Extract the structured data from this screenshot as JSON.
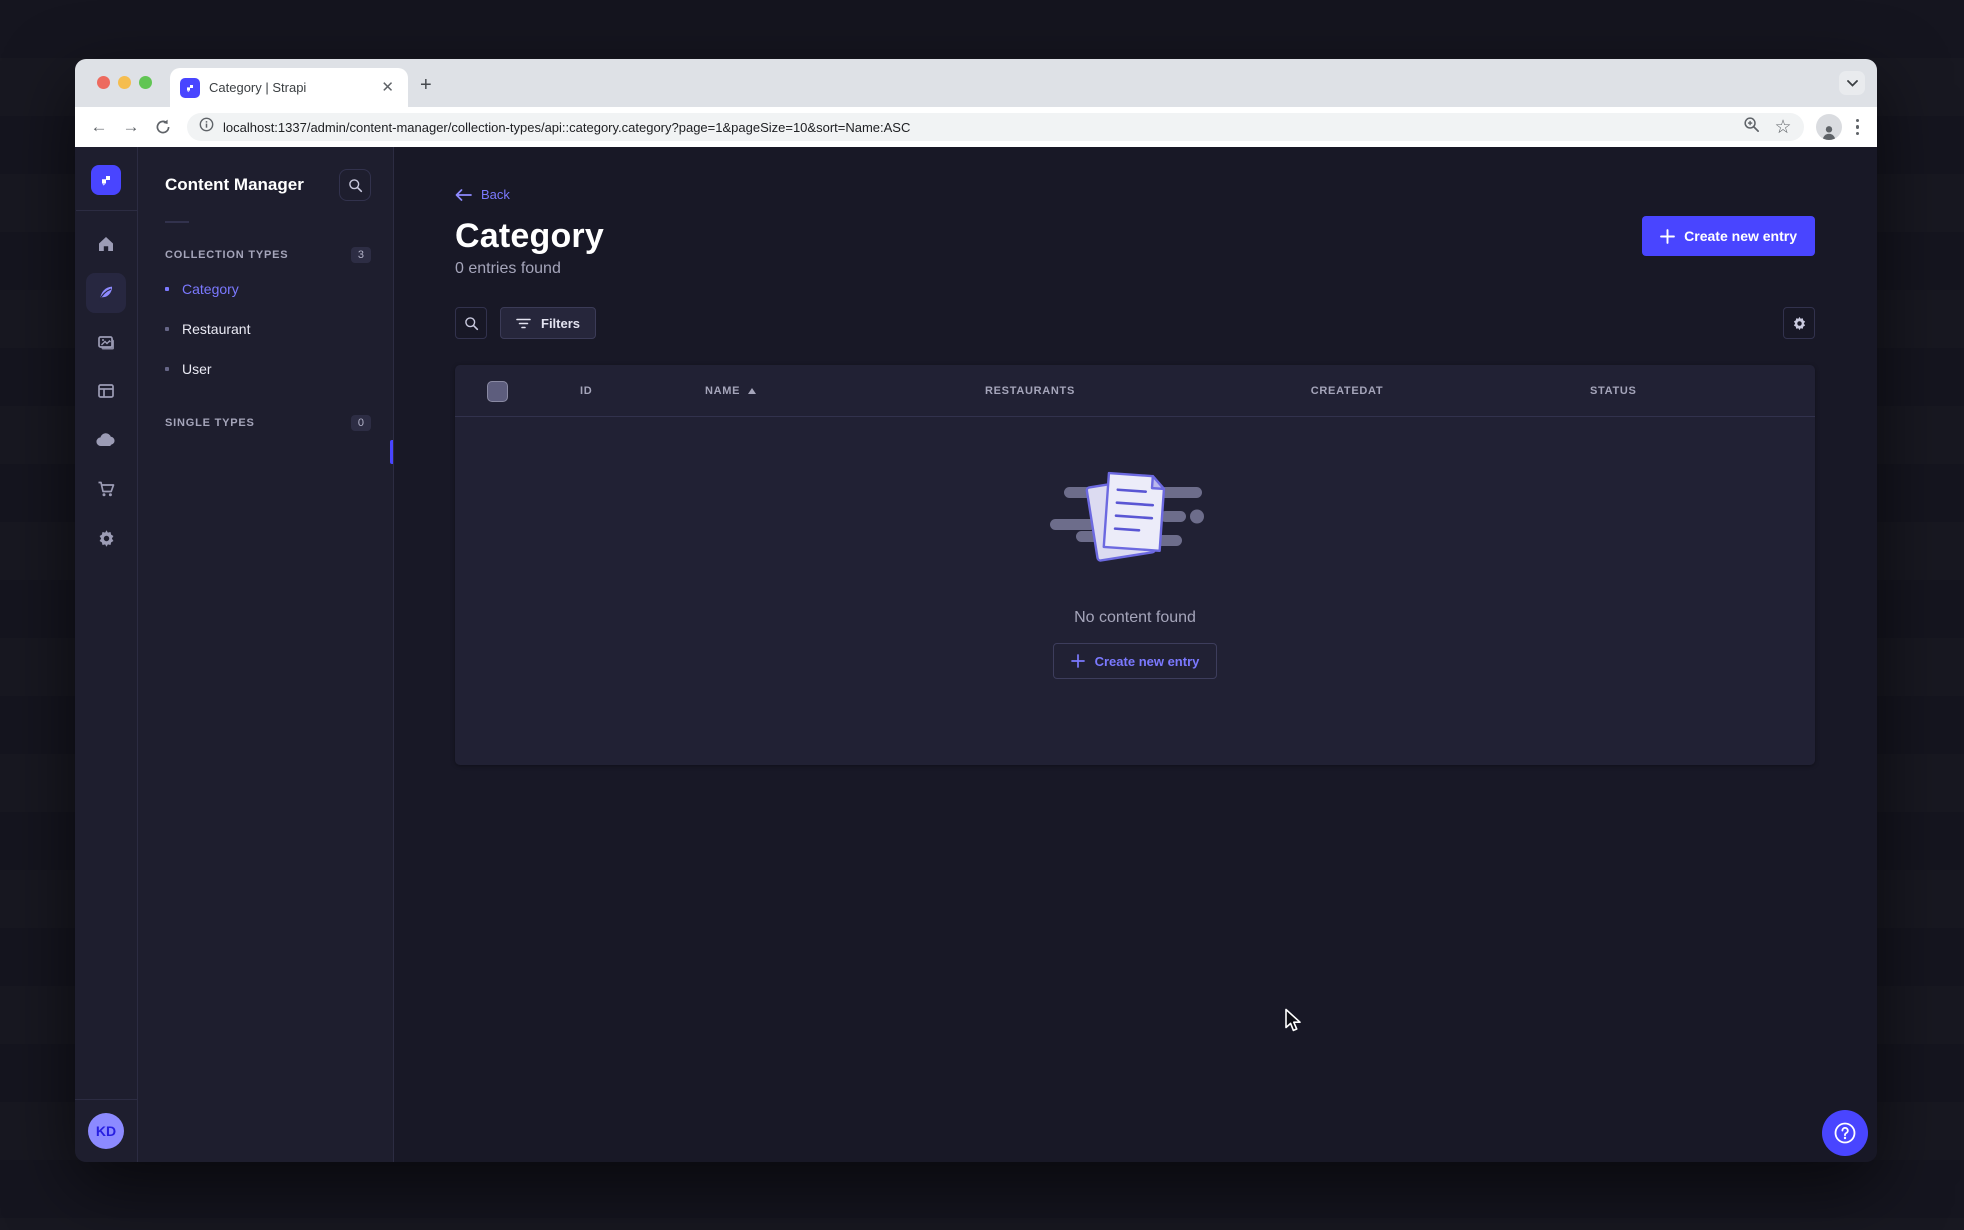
{
  "colors": {
    "primary": "#4945ff",
    "primary_light": "#7b79ff",
    "surface": "#212134",
    "background": "#181826",
    "border": "#32324d",
    "muted_text": "#a5a5ba"
  },
  "browser": {
    "tab_title": "Category | Strapi",
    "url": "localhost:1337/admin/content-manager/collection-types/api::category.category?page=1&pageSize=10&sort=Name:ASC"
  },
  "icons": {
    "rail": [
      "strapi-logo",
      "home",
      "content-feather",
      "media-library",
      "content-type-builder",
      "cloud",
      "marketplace-cart",
      "settings-gear"
    ],
    "urlbar": [
      "back-arrow",
      "forward-arrow",
      "reload",
      "page-info",
      "zoom",
      "bookmark-star",
      "profile",
      "menu-kebab"
    ]
  },
  "nav_panel": {
    "title": "Content Manager",
    "sections": [
      {
        "label": "COLLECTION TYPES",
        "badge": "3",
        "items": [
          {
            "label": "Category",
            "active": true
          },
          {
            "label": "Restaurant",
            "active": false
          },
          {
            "label": "User",
            "active": false
          }
        ]
      },
      {
        "label": "SINGLE TYPES",
        "badge": "0",
        "items": []
      }
    ]
  },
  "main": {
    "back_label": "Back",
    "title": "Category",
    "subtitle": "0 entries found",
    "create_button": "Create new entry",
    "filters_button": "Filters",
    "table": {
      "headers": [
        "ID",
        "NAME",
        "RESTAURANTS",
        "CREATEDAT",
        "STATUS"
      ],
      "sorted_by": "NAME",
      "sort_direction": "ascending",
      "rows": []
    },
    "empty_state": {
      "message": "No content found",
      "create_button": "Create new entry"
    }
  },
  "user": {
    "initials": "KD"
  }
}
